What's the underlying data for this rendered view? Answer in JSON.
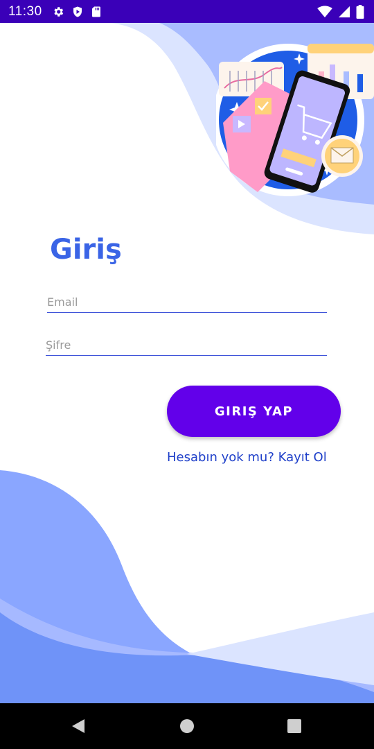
{
  "status_bar": {
    "time": "11:30",
    "left_icons": [
      "gear-icon",
      "shield-play-icon",
      "sd-card-icon"
    ],
    "right_icons": [
      "wifi-icon",
      "signal-icon",
      "battery-icon"
    ],
    "background": "#3a00b8"
  },
  "login": {
    "title": "Giriş",
    "email_placeholder": "Email",
    "password_placeholder": "Şifre",
    "submit_label": "GIRIŞ YAP",
    "register_link": "Hesabın yok mu? Kayıt Ol"
  },
  "colors": {
    "accent": "#6200ea",
    "title": "#3a64e6",
    "link": "#1e3fc9",
    "wave_light": "#d6e0ff",
    "wave_mid": "#a6baff",
    "wave_dark": "#7b9cfb"
  },
  "nav_bar": {
    "buttons": [
      "back-icon",
      "home-icon",
      "recents-icon"
    ]
  }
}
